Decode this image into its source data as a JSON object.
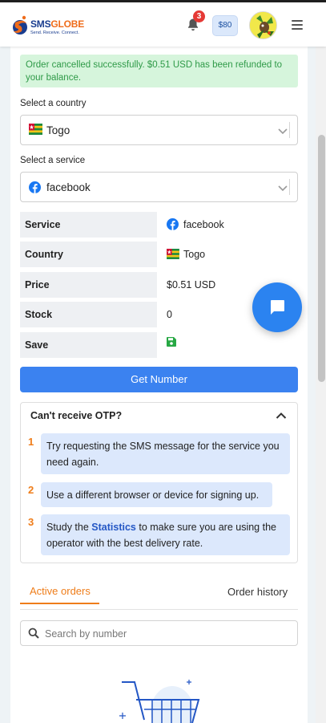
{
  "header": {
    "logo_brand_a": "SMS",
    "logo_brand_b": "GLOBE",
    "logo_tagline": "Send. Receive. Connect.",
    "notification_count": "3",
    "balance": "$80"
  },
  "alert": {
    "message": "Order cancelled successfully. $0.51 USD has been refunded to your balance."
  },
  "country_select": {
    "label": "Select a country",
    "value": "Togo"
  },
  "service_select": {
    "label": "Select a service",
    "value": "facebook"
  },
  "info": {
    "service_label": "Service",
    "service_value": "facebook",
    "country_label": "Country",
    "country_value": "Togo",
    "price_label": "Price",
    "price_value": "$0.51 USD",
    "stock_label": "Stock",
    "stock_value": "0",
    "save_label": "Save"
  },
  "get_number_button": "Get Number",
  "otp_help": {
    "title": "Can't receive OTP?",
    "steps": [
      {
        "num": "1",
        "text": "Try requesting the SMS message for the service you need again."
      },
      {
        "num": "2",
        "text": "Use a different browser or device for signing up."
      },
      {
        "num": "3",
        "text_before": "Study the ",
        "link": "Statistics",
        "text_after": " to make sure you are using the operator with the best delivery rate."
      }
    ]
  },
  "tabs": {
    "active": "Active orders",
    "inactive": "Order history"
  },
  "search": {
    "placeholder": "Search by number"
  },
  "colors": {
    "accent_orange": "#ef7d1a",
    "primary_blue": "#3b82f0",
    "success_green": "#2f9a48",
    "brand_navy": "#1a3d8f"
  },
  "icons": {
    "bell": "bell-icon",
    "menu": "hamburger-menu-icon",
    "chat": "chat-bubble-icon",
    "save": "floppy-disk-icon",
    "search": "magnifier-icon",
    "chevron": "chevron-down-icon",
    "collapse": "chevron-up-icon"
  }
}
